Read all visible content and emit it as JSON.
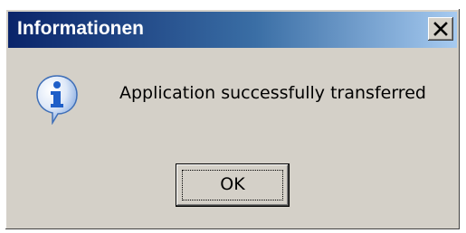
{
  "dialog": {
    "title": "Informationen",
    "message": "Application successfully transferred",
    "ok_label": "OK",
    "icon": "info-icon",
    "close_icon": "close-icon"
  },
  "colors": {
    "window_face": "#d4d0c8",
    "titlebar_start": "#0a246a",
    "titlebar_end": "#a6caf0",
    "icon_blue": "#1f5fc8"
  }
}
